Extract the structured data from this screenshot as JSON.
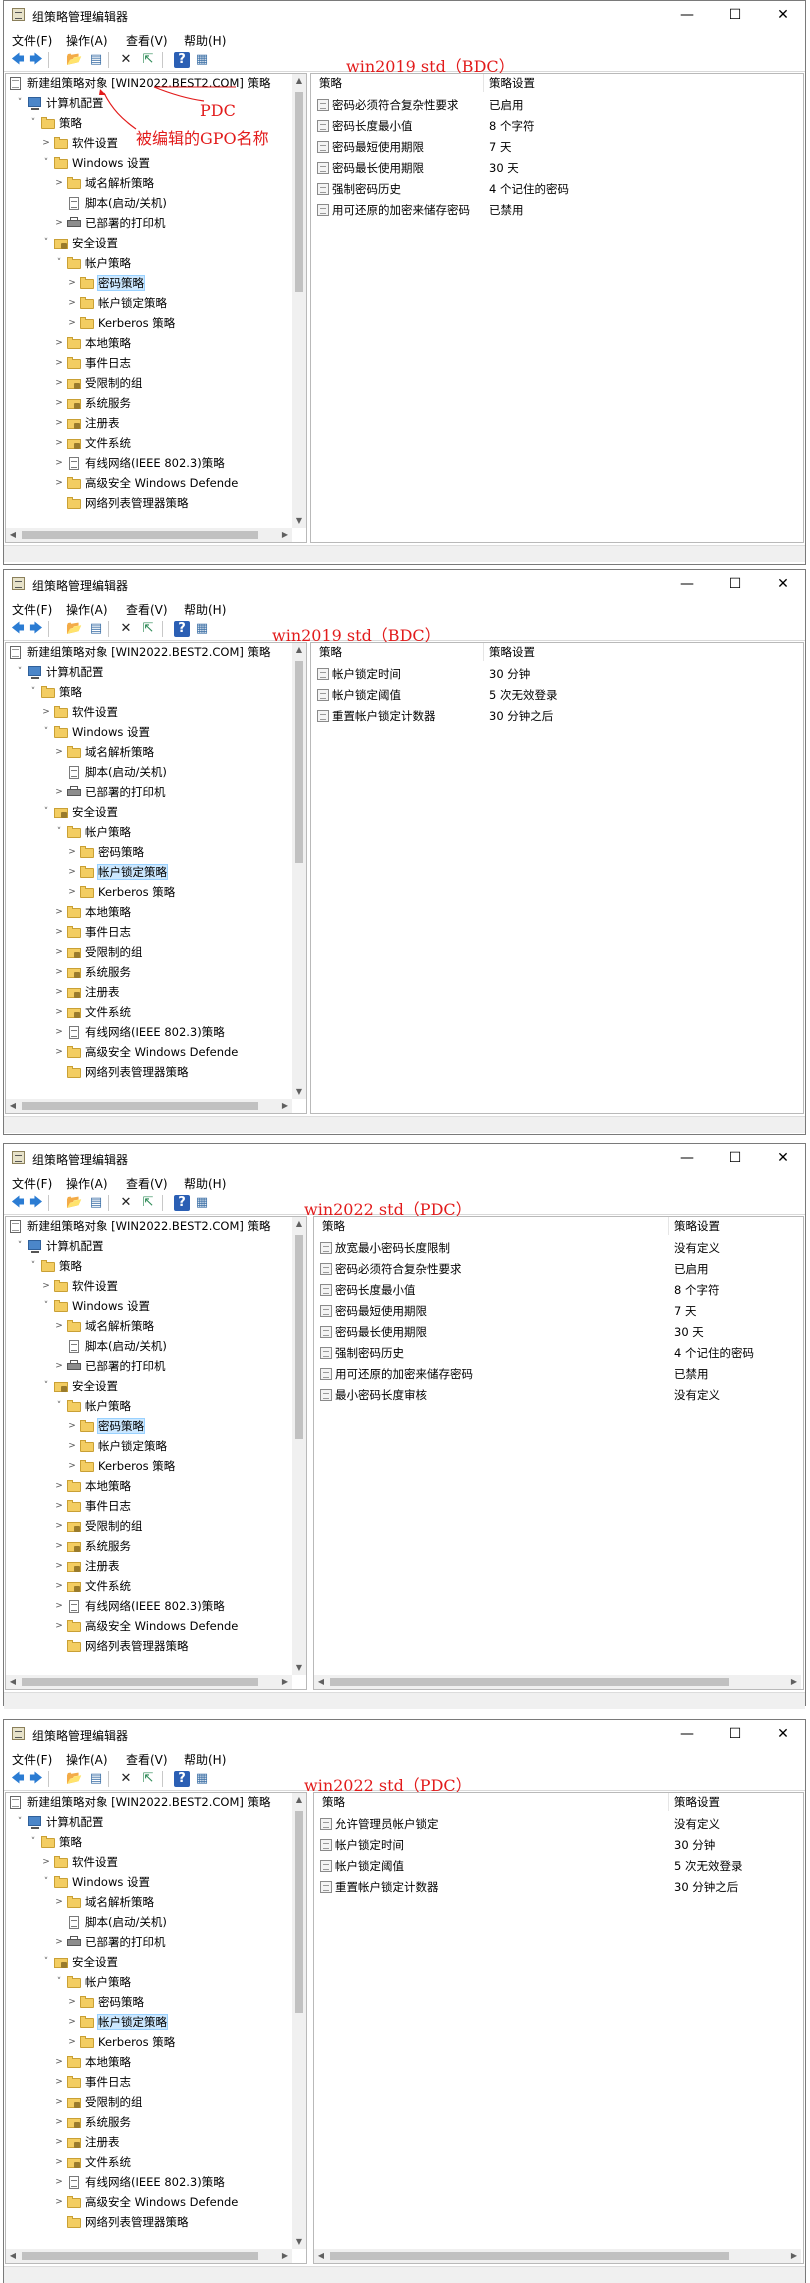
{
  "app": {
    "title": "组策略管理编辑器",
    "menu": [
      "文件(F)",
      "操作(A)",
      "查看(V)",
      "帮助(H)"
    ],
    "window_controls": [
      "—",
      "☐",
      "✕"
    ]
  },
  "toolbar_icons": [
    "back-arrow-icon",
    "forward-arrow-icon",
    "up-folder-icon",
    "show-tree-icon",
    "delete-icon",
    "export-icon",
    "help-icon",
    "properties-icon"
  ],
  "windows": [
    {
      "annotation": "win2019 std（BDC）",
      "extra_annotations": [
        "PDC",
        "被编辑的GPO名称"
      ],
      "tree_root": "新建组策略对象 [WIN2022.BEST2.COM] 策略",
      "selected": "密码策略",
      "columns": [
        "策略",
        "策略设置"
      ],
      "policies": [
        [
          "密码必须符合复杂性要求",
          "已启用"
        ],
        [
          "密码长度最小值",
          "8 个字符"
        ],
        [
          "密码最短使用期限",
          "7 天"
        ],
        [
          "密码最长使用期限",
          "30 天"
        ],
        [
          "强制密码历史",
          "4 个记住的密码"
        ],
        [
          "用可还原的加密来储存密码",
          "已禁用"
        ]
      ]
    },
    {
      "annotation": "win2019 std（BDC）",
      "tree_root": "新建组策略对象 [WIN2022.BEST2.COM] 策略",
      "selected": "帐户锁定策略",
      "columns": [
        "策略",
        "策略设置"
      ],
      "policies": [
        [
          "帐户锁定时间",
          "30 分钟"
        ],
        [
          "帐户锁定阈值",
          "5 次无效登录"
        ],
        [
          "重置帐户锁定计数器",
          "30 分钟之后"
        ]
      ]
    },
    {
      "annotation": "win2022 std（PDC）",
      "tree_root": "新建组策略对象 [WIN2022.BEST2.COM] 策略",
      "selected": "密码策略",
      "columns": [
        "策略",
        "策略设置"
      ],
      "policies": [
        [
          "放宽最小密码长度限制",
          "没有定义"
        ],
        [
          "密码必须符合复杂性要求",
          "已启用"
        ],
        [
          "密码长度最小值",
          "8 个字符"
        ],
        [
          "密码最短使用期限",
          "7 天"
        ],
        [
          "密码最长使用期限",
          "30 天"
        ],
        [
          "强制密码历史",
          "4 个记住的密码"
        ],
        [
          "用可还原的加密来储存密码",
          "已禁用"
        ],
        [
          "最小密码长度审核",
          "没有定义"
        ]
      ]
    },
    {
      "annotation": "win2022 std（PDC）",
      "tree_root": "新建组策略对象 [WIN2022.BEST2.COM] 策略",
      "selected": "帐户锁定策略",
      "columns": [
        "策略",
        "策略设置"
      ],
      "policies": [
        [
          "允许管理员帐户锁定",
          "没有定义"
        ],
        [
          "帐户锁定时间",
          "30 分钟"
        ],
        [
          "帐户锁定阈值",
          "5 次无效登录"
        ],
        [
          "重置帐户锁定计数器",
          "30 分钟之后"
        ]
      ]
    }
  ],
  "tree": [
    {
      "label": "计算机配置",
      "icon": "computer"
    },
    {
      "label": "策略",
      "icon": "folder"
    },
    {
      "label": "软件设置",
      "icon": "folder"
    },
    {
      "label": "Windows 设置",
      "icon": "folder"
    },
    {
      "label": "域名解析策略",
      "icon": "folder"
    },
    {
      "label": "脚本(启动/关机)",
      "icon": "doc"
    },
    {
      "label": "已部署的打印机",
      "icon": "printer"
    },
    {
      "label": "安全设置",
      "icon": "lockfolder"
    },
    {
      "label": "帐户策略",
      "icon": "folder"
    },
    {
      "label": "密码策略",
      "icon": "folder"
    },
    {
      "label": "帐户锁定策略",
      "icon": "folder"
    },
    {
      "label": "Kerberos 策略",
      "icon": "folder"
    },
    {
      "label": "本地策略",
      "icon": "folder"
    },
    {
      "label": "事件日志",
      "icon": "folder"
    },
    {
      "label": "受限制的组",
      "icon": "lockfolder"
    },
    {
      "label": "系统服务",
      "icon": "lockfolder"
    },
    {
      "label": "注册表",
      "icon": "lockfolder"
    },
    {
      "label": "文件系统",
      "icon": "lockfolder"
    },
    {
      "label": "有线网络(IEEE 802.3)策略",
      "icon": "doc"
    },
    {
      "label": "高级安全 Windows Defende",
      "icon": "folder"
    },
    {
      "label": "网络列表管理器策略",
      "icon": "folder"
    }
  ]
}
